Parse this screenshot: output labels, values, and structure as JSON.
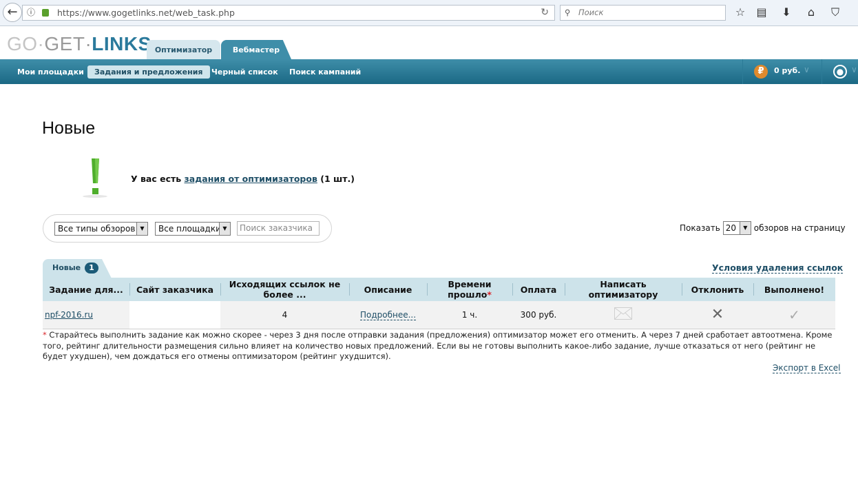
{
  "browser": {
    "url": "https://www.gogetlinks.net/web_task.php",
    "search_placeholder": "Поиск",
    "icons": [
      "back-icon",
      "info-icon",
      "lock-icon",
      "reload-icon",
      "search-icon",
      "star-icon",
      "reading-list-icon",
      "download-icon",
      "home-icon",
      "pocket-icon"
    ]
  },
  "header": {
    "logo": {
      "go": "GO·",
      "get": "GET·",
      "links": "LINKS"
    },
    "tabs": [
      "Оптимизатор",
      "Вебмастер"
    ],
    "active_tab": "Вебмастер"
  },
  "nav": {
    "items": [
      "Мои площадки",
      "Задания и предложения",
      "Черный список",
      "Поиск кампаний"
    ],
    "active": "Задания и предложения",
    "balance": "0 руб.",
    "colors": {
      "bar": "#1b6884",
      "accent": "#3f8ea9",
      "coin": "#e08a2d"
    }
  },
  "page": {
    "title": "Новые",
    "notice": {
      "prefix": "У вас есть",
      "link": "задания от оптимизаторов",
      "suffix": "(1 шт.)"
    },
    "filters": {
      "type": "Все типы обзоров",
      "site": "Все площадки",
      "customer_placeholder": "Поиск заказчика"
    },
    "per_page": {
      "prefix": "Показать",
      "value": "20",
      "suffix": "обзоров на страницу"
    },
    "list_tab": {
      "label": "Новые",
      "count": "1"
    },
    "removal_link": "Условия удаления ссылок",
    "table": {
      "headers": [
        "Задание для...",
        "Сайт заказчика",
        "Исходящих ссылок не более ...",
        "Описание",
        "Времени прошло",
        "Оплата",
        "Написать оптимизатору",
        "Отклонить",
        "Выполнено!"
      ],
      "rows": [
        {
          "site": "npf-2016.ru",
          "customer": "",
          "links": "4",
          "description": "Подробнее...",
          "elapsed": "1 ч.",
          "payment": "300 руб."
        }
      ]
    },
    "footnote": "Старайтесь выполнить задание как можно скорее - через 3 дня после отправки задания (предложения) оптимизатор может его отменить. А через 7 дней сработает автоотмена. Кроме того, рейтинг длительности размещения сильно влияет на количество новых предложений. Если вы не готовы выполнить какое-либо задание, лучше отказаться от него (рейтинг не будет ухудшен), чем дождаться его отмены оптимизатором (рейтинг ухудшится).",
    "export": "Экспорт в Excel"
  }
}
